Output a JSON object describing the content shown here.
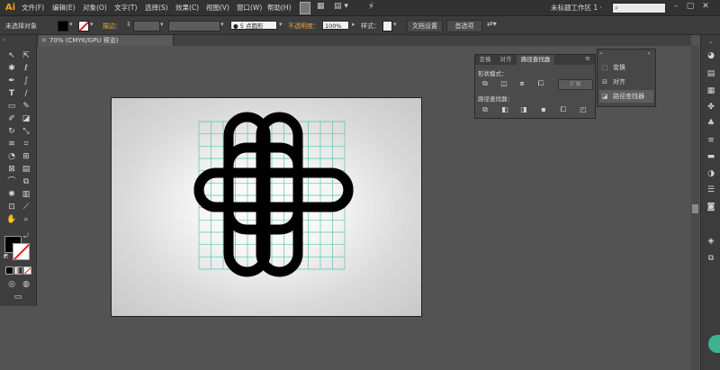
{
  "app": {
    "logo": "Ai"
  },
  "menu": {
    "items": [
      "文件(F)",
      "编辑(E)",
      "对象(O)",
      "文字(T)",
      "选择(S)",
      "效果(C)",
      "视图(V)",
      "窗口(W)",
      "帮助(H)"
    ],
    "workspace": "未标题工作区 1 ·",
    "search_icon": "search-icon"
  },
  "control": {
    "selection_label": "未选择对象",
    "stroke_label": "描边：",
    "brush_label": "5 点圆形",
    "opacity_label": "不透明度：",
    "opacity_value": "100%",
    "style_label": "样式：",
    "doc_settings": "文档设置",
    "preferences": "首选项"
  },
  "document": {
    "tab_title": "70% (CMYK/GPU 预览)"
  },
  "pathfinder": {
    "tabs": [
      "变换",
      "对齐",
      "路径查找器"
    ],
    "shape_modes_label": "形状模式：",
    "expand_label": "扩展",
    "pathfinders_label": "路径查找器："
  },
  "dock": {
    "items": [
      {
        "label": "变换",
        "icon": "transform-icon"
      },
      {
        "label": "对齐",
        "icon": "align-icon"
      },
      {
        "label": "路径查找器",
        "icon": "pathfinder-icon"
      }
    ]
  },
  "colors": {
    "accent": "#f7a21c",
    "grid": "#49c2a0",
    "knot": "#000000",
    "badge": "#3fb28f"
  }
}
